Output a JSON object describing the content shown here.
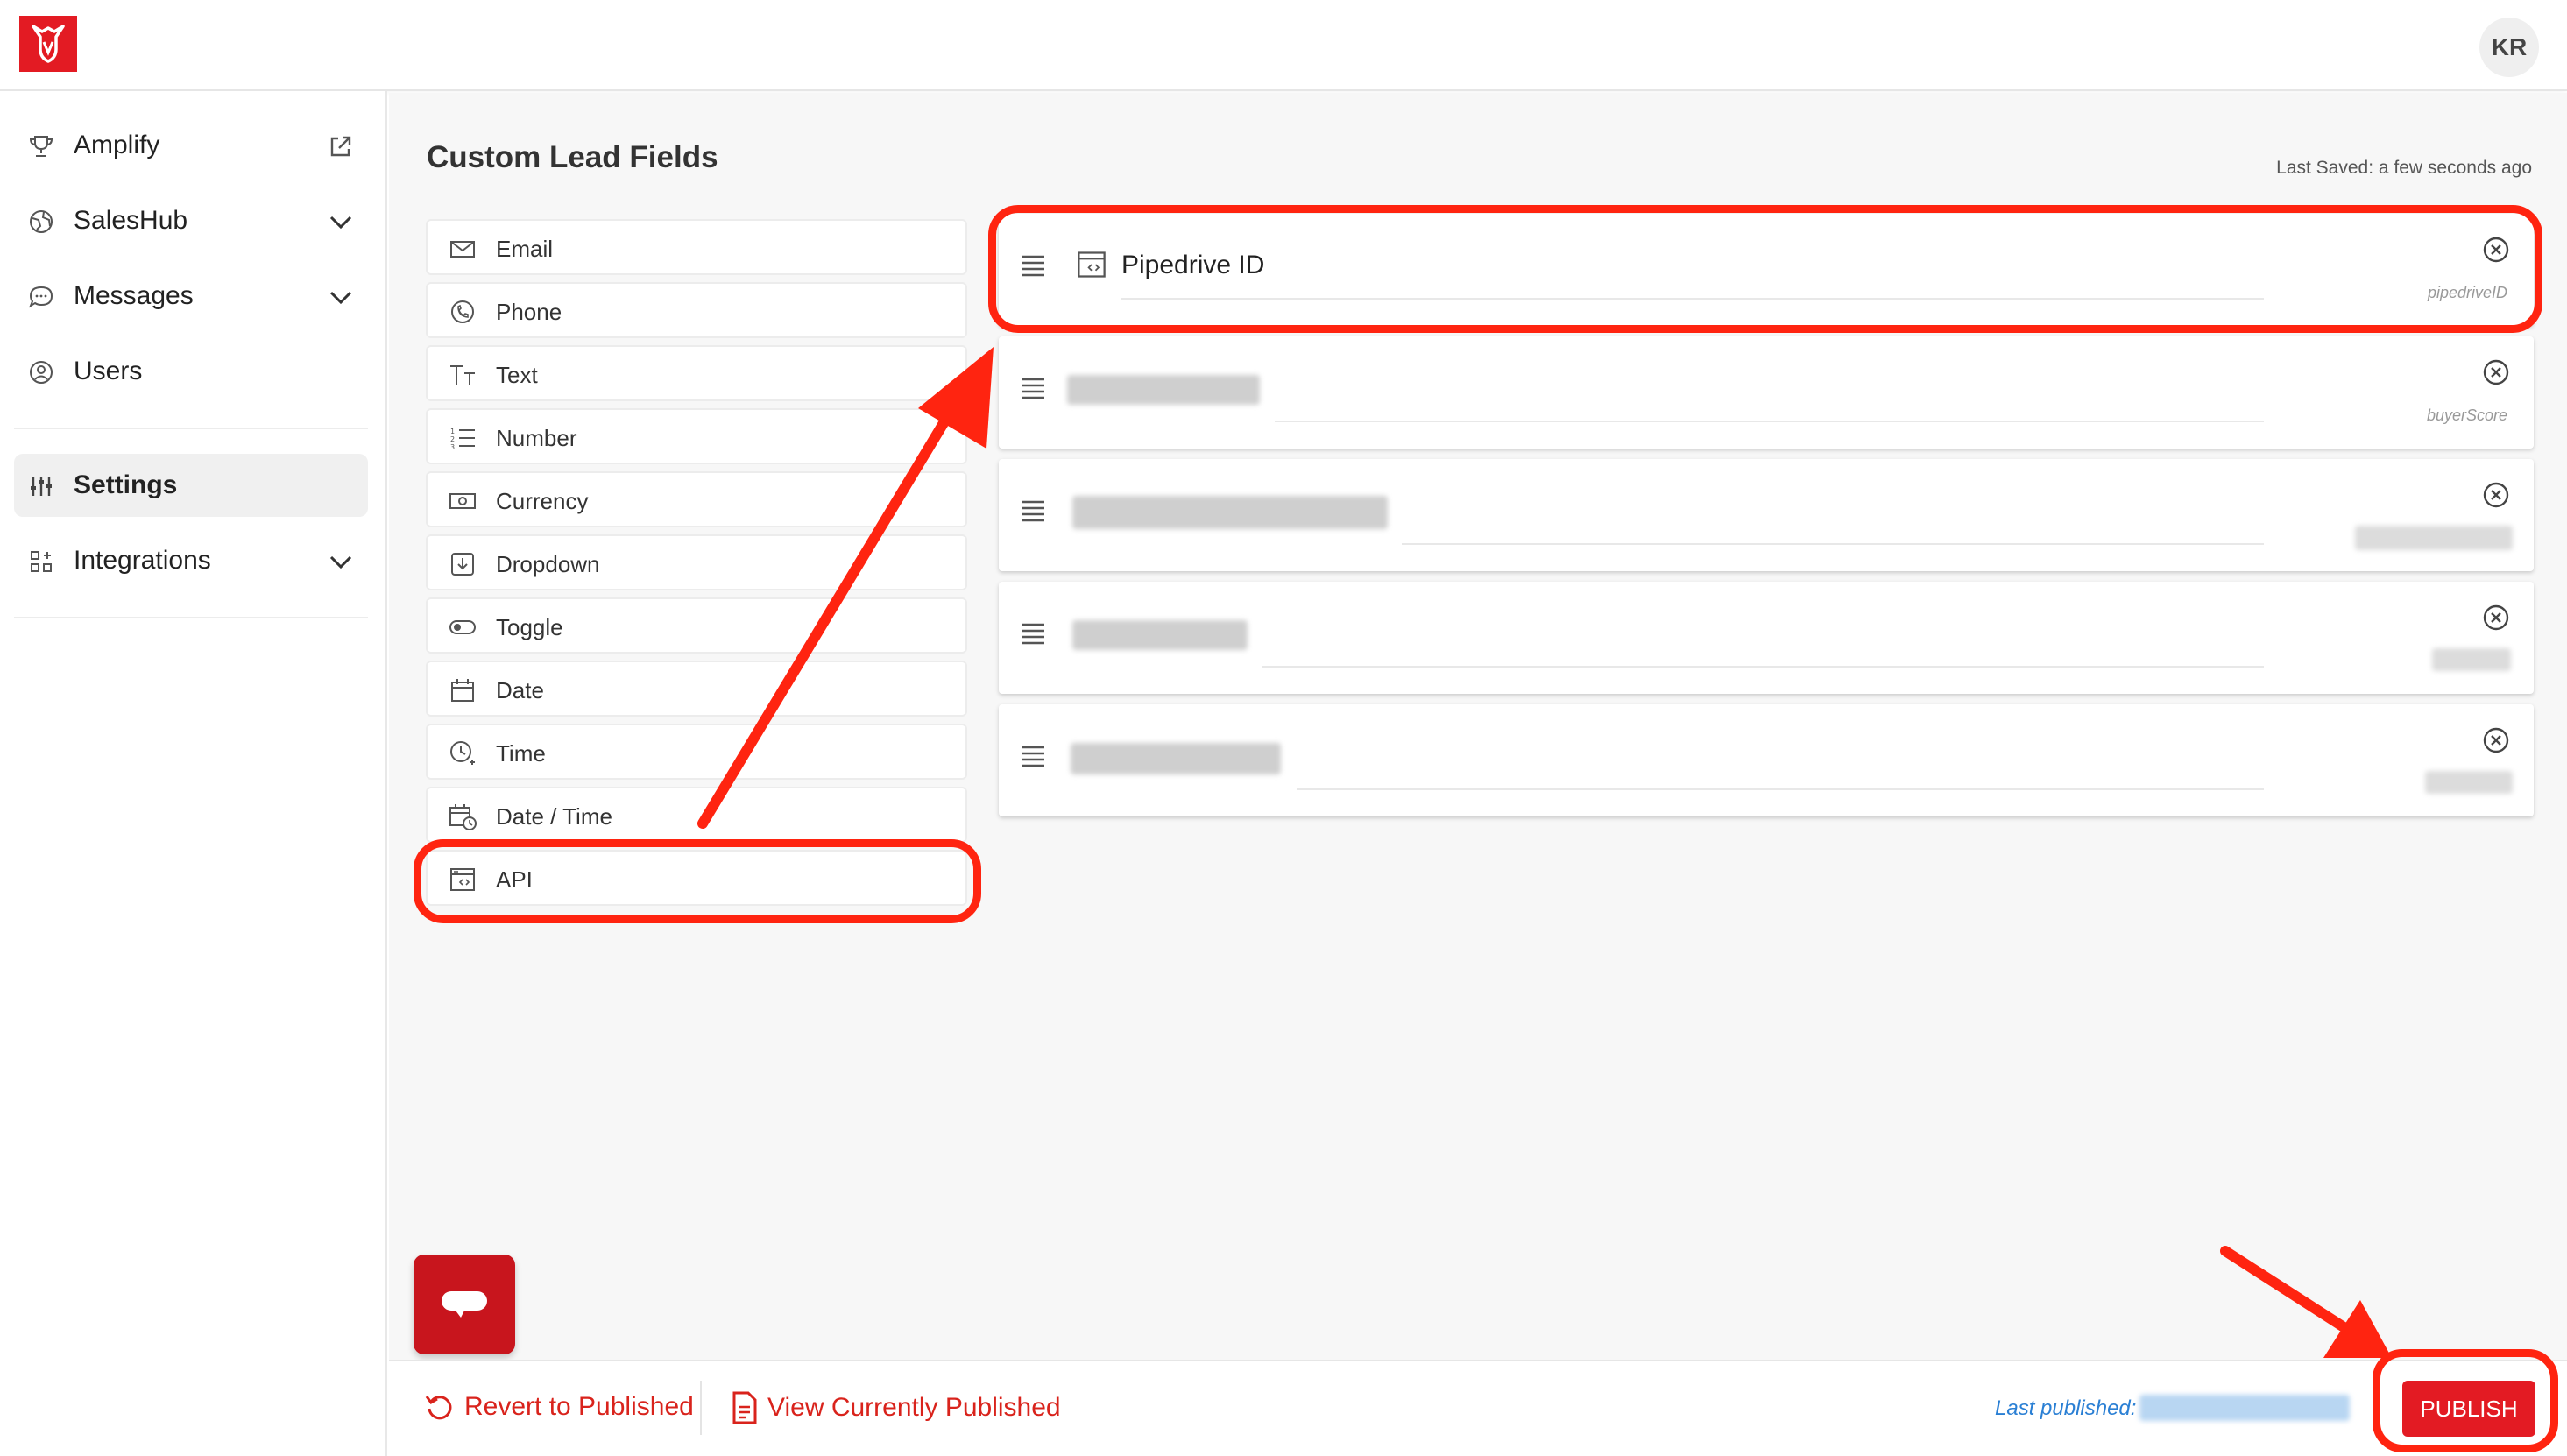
{
  "header": {
    "avatar_initials": "KR"
  },
  "sidebar": {
    "items": [
      {
        "label": "Amplify",
        "icon": "trophy-icon",
        "right": "external-link-icon"
      },
      {
        "label": "SalesHub",
        "icon": "globe-icon",
        "right": "chevron-down-icon"
      },
      {
        "label": "Messages",
        "icon": "chat-bubble-icon",
        "right": "chevron-down-icon"
      },
      {
        "label": "Users",
        "icon": "user-circle-icon",
        "right": ""
      },
      {
        "label": "Settings",
        "icon": "sliders-icon",
        "right": "",
        "active": true
      },
      {
        "label": "Integrations",
        "icon": "grid-icon",
        "right": "chevron-down-icon"
      }
    ]
  },
  "main": {
    "title": "Custom Lead Fields",
    "last_saved": "Last Saved:  a few seconds ago",
    "field_types": [
      {
        "label": "Email",
        "icon": "envelope-icon"
      },
      {
        "label": "Phone",
        "icon": "phone-icon"
      },
      {
        "label": "Text",
        "icon": "text-icon"
      },
      {
        "label": "Number",
        "icon": "list-number-icon"
      },
      {
        "label": "Currency",
        "icon": "banknote-icon"
      },
      {
        "label": "Dropdown",
        "icon": "dropdown-icon"
      },
      {
        "label": "Toggle",
        "icon": "toggle-icon"
      },
      {
        "label": "Date",
        "icon": "calendar-icon"
      },
      {
        "label": "Time",
        "icon": "clock-icon"
      },
      {
        "label": "Date / Time",
        "icon": "calendar-clock-icon"
      },
      {
        "label": "API",
        "icon": "api-window-icon"
      }
    ],
    "fields": [
      {
        "name": "Pipedrive ID",
        "key": "pipedriveID"
      },
      {
        "name": "",
        "key": "buyerScore"
      },
      {
        "name": "",
        "key": ""
      },
      {
        "name": "",
        "key": ""
      },
      {
        "name": "",
        "key": ""
      }
    ]
  },
  "footer": {
    "revert_label": "Revert to Published",
    "view_label": "View Currently Published",
    "last_published_label": "Last published:",
    "publish_label": "PUBLISH"
  },
  "colors": {
    "brand": "#e31b23",
    "annotation": "#ff2410",
    "link": "#2a7fd4"
  }
}
